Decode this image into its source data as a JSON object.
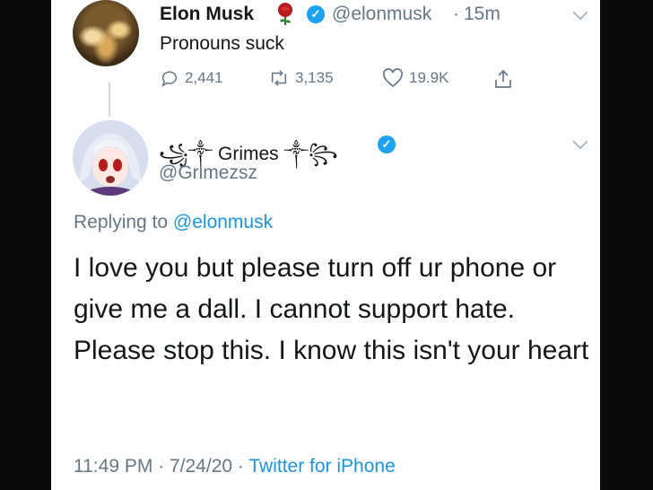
{
  "tweet1": {
    "name": "Elon Musk",
    "handle": "@elonmusk",
    "separator": "·",
    "time": "15m",
    "text": "Pronouns suck",
    "replies": "2,441",
    "retweets": "3,135",
    "likes": "19.9K"
  },
  "tweet2": {
    "name": "꧁༒ Grimes ༒꧂",
    "handle": "@Grimezsz",
    "replying_prefix": "Replying to",
    "replying_to": "@elonmusk",
    "text": "I love you but please turn off ur phone or give me a dall.  I cannot support hate.  Please stop this. I know this isn't your heart",
    "time": "11:49 PM · 7/24/20 ·",
    "source": "Twitter for iPhone"
  },
  "colors": {
    "verified": "#1da1f2",
    "link": "#1b95e0",
    "secondary_text": "#657786",
    "primary_text": "#14171a",
    "background": "#0b0b0b"
  },
  "icons": [
    "rose-icon",
    "verified-badge-icon",
    "chevron-down-icon",
    "reply-icon",
    "retweet-icon",
    "like-icon",
    "share-icon"
  ]
}
